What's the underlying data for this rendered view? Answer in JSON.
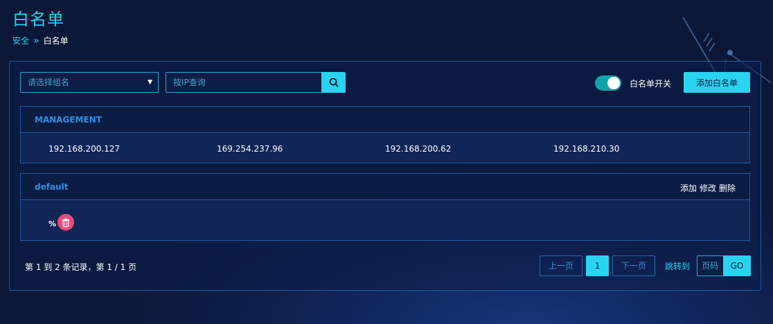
{
  "header": {
    "title": "白名单",
    "breadcrumb": {
      "parent": "安全",
      "separator": "»",
      "current": "白名单"
    }
  },
  "toolbar": {
    "group_select_placeholder": "请选择组名",
    "search_placeholder": "按IP查询",
    "toggle_label": "白名单开关",
    "toggle_on": true,
    "add_label": "添加白名单"
  },
  "groups": [
    {
      "name": "MANAGEMENT",
      "ips": [
        "192.168.200.127",
        "169.254.237.96",
        "192.168.200.62",
        "192.168.210.30"
      ]
    },
    {
      "name": "default",
      "actions": {
        "add": "添加",
        "edit": "修改",
        "delete": "删除"
      },
      "entries": [
        "%"
      ]
    }
  ],
  "footer": {
    "records": "第 1 到 2 条记录，第 1 / 1 页",
    "prev": "上一页",
    "current_page": "1",
    "next": "下一页",
    "jump_label": "跳转到",
    "page_placeholder": "页码",
    "go": "GO"
  },
  "colors": {
    "accent": "#29d4f0",
    "toggle": "#12a3a8",
    "delete": "#ec4a77",
    "background": "#0b1a3e"
  }
}
